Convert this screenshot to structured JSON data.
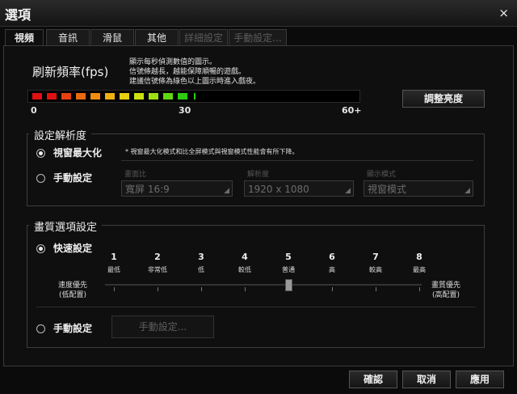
{
  "window": {
    "title": "選項",
    "close_icon": "×"
  },
  "tabs": [
    {
      "label": "視頻",
      "active": true
    },
    {
      "label": "音訊"
    },
    {
      "label": "滑鼠"
    },
    {
      "label": "其他"
    },
    {
      "label": "詳細設定",
      "disabled": true
    },
    {
      "label": "手動設定...",
      "disabled": true
    }
  ],
  "fps": {
    "title": "刷新頻率(fps)",
    "desc": [
      "顯示每秒偵測數值的圖示。",
      "信號條越長，越能保障順暢的遊戲。",
      "建議信號條為綠色以上圖示時進入戲夜。"
    ],
    "min": "0",
    "mid": "30",
    "max": "60+",
    "segments": [
      "#e01010",
      "#e01010",
      "#e84010",
      "#e86a10",
      "#f08c10",
      "#f0b010",
      "#e6d010",
      "#c8e010",
      "#9ee010",
      "#5ed810",
      "#2ecc10"
    ],
    "brightness_button": "調整亮度"
  },
  "resolution": {
    "legend": "設定解析度",
    "window_max_label": "視窗最大化",
    "window_max_note": "* 視窗最大化模式和比全屏模式與視窗模式性能會有所下降。",
    "manual_label": "手動設定",
    "aspect_label": "畫面比",
    "aspect_value": "寬屏 16:9",
    "res_label": "解析度",
    "res_value": "1920 x 1080",
    "mode_label": "顯示模式",
    "mode_value": "視窗模式",
    "selected": "window_max"
  },
  "quality": {
    "legend": "畫質選項設定",
    "quick_label": "快速設定",
    "levels": [
      {
        "num": "1",
        "text": "最低"
      },
      {
        "num": "2",
        "text": "非常低"
      },
      {
        "num": "3",
        "text": "低"
      },
      {
        "num": "4",
        "text": "較低"
      },
      {
        "num": "5",
        "text": "普通"
      },
      {
        "num": "6",
        "text": "高"
      },
      {
        "num": "7",
        "text": "較高"
      },
      {
        "num": "8",
        "text": "最高"
      }
    ],
    "current_level": 5,
    "left_label": [
      "速度優先",
      "(低配置)"
    ],
    "right_label": [
      "畫質優先",
      "(高配置)"
    ],
    "manual_label": "手動設定",
    "manual_button": "手動設定..."
  },
  "footer": {
    "confirm": "確認",
    "cancel": "取消",
    "apply": "應用"
  }
}
